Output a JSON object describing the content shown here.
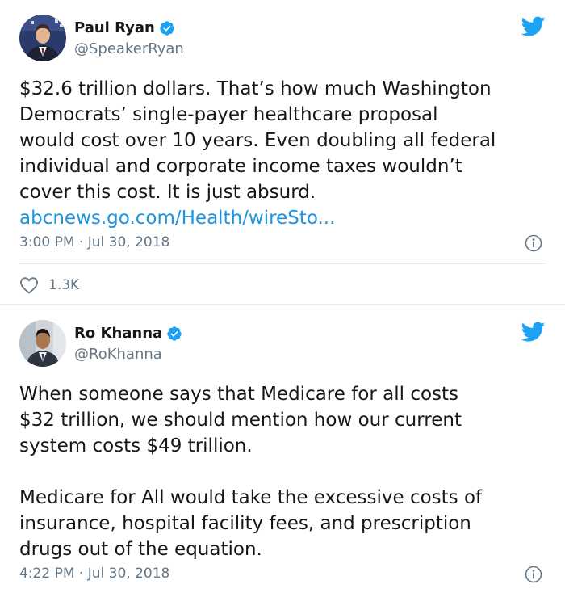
{
  "tweets": [
    {
      "name": "Paul Ryan",
      "handle": "@SpeakerRyan",
      "text": "$32.6 trillion dollars. That’s how much Washington\nDemocrats’ single-payer healthcare proposal\nwould cost over 10 years. Even doubling all federal\nindividual and corporate income taxes wouldn’t\ncover this cost. It is just absurd.",
      "link": "abcnews.go.com/Health/wireSto...",
      "timestamp": "3:00 PM · Jul 30, 2018",
      "likes": "1.3K"
    },
    {
      "name": "Ro Khanna",
      "handle": "@RoKhanna",
      "text": "When someone says that Medicare for all costs\n$32 trillion, we should mention how our current\nsystem costs $49 trillion.\n\nMedicare for All would take the excessive costs of\ninsurance, hospital facility fees, and prescription\ndrugs out of the equation.",
      "timestamp": "4:22 PM · Jul 30, 2018"
    }
  ],
  "colors": {
    "text": "#14171a",
    "secondary": "#657786",
    "link": "#1b95e0",
    "twitter_blue": "#1da1f2",
    "divider": "#e1e8ed"
  },
  "icons": [
    "verified-badge-icon",
    "twitter-bird-icon",
    "info-icon",
    "heart-icon"
  ]
}
